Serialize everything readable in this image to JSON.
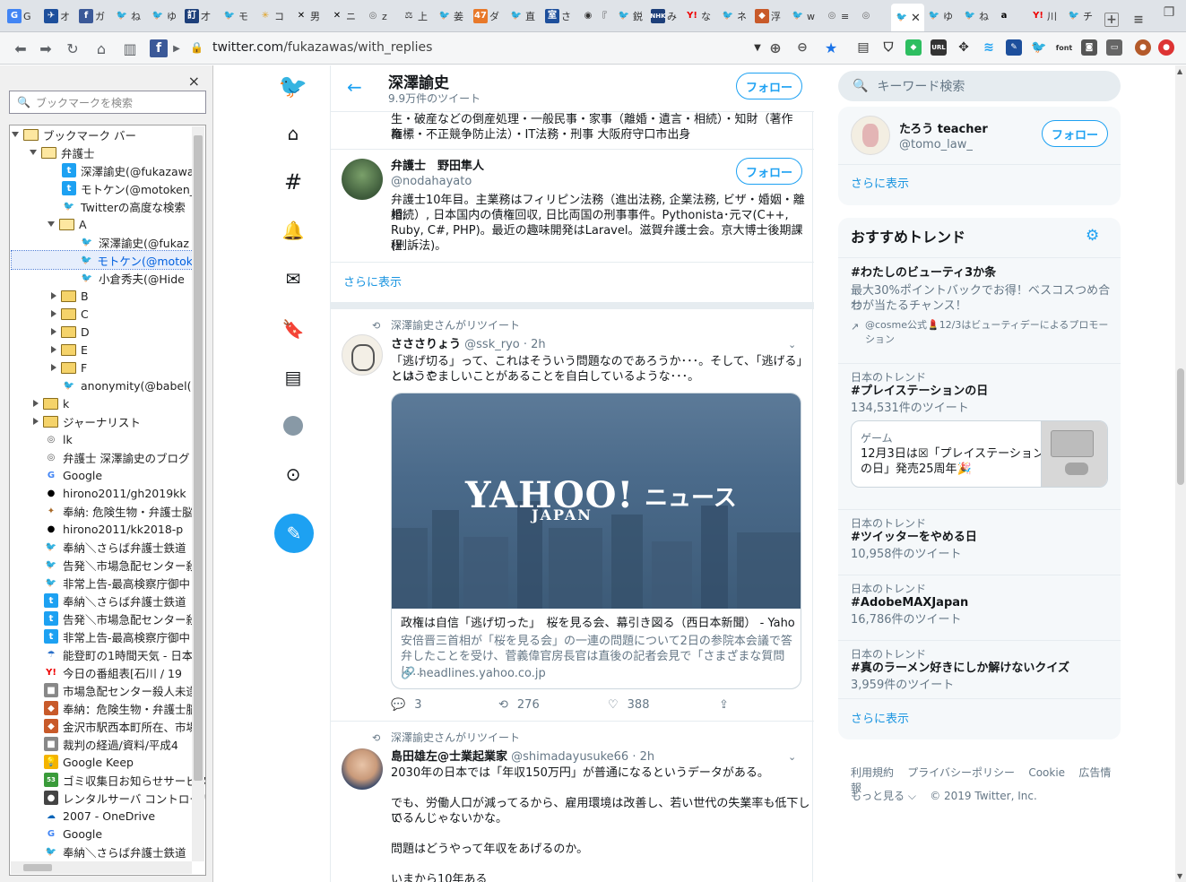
{
  "tabs": [
    {
      "label": "G"
    },
    {
      "label": "オ"
    },
    {
      "label": "ガ"
    },
    {
      "label": "ね"
    },
    {
      "label": "ゆ"
    },
    {
      "label": "才"
    },
    {
      "label": "訂"
    },
    {
      "label": "モ"
    },
    {
      "label": "コ"
    },
    {
      "label": "男"
    },
    {
      "label": "ニ"
    },
    {
      "label": "z"
    },
    {
      "label": "上"
    },
    {
      "label": "姜"
    },
    {
      "label": "ダ"
    },
    {
      "label": "直"
    },
    {
      "label": "さ"
    },
    {
      "label": "『"
    },
    {
      "label": "鋭"
    },
    {
      "label": "み"
    },
    {
      "label": "な"
    },
    {
      "label": "ネ"
    },
    {
      "label": "浮"
    },
    {
      "label": "w"
    },
    {
      "label": "≡"
    },
    {
      "label": "ゆ"
    },
    {
      "label": "ね"
    },
    {
      "label": "川"
    },
    {
      "label": "チ"
    }
  ],
  "url": {
    "host": "twitter.com",
    "path": "/fukazawas/with_replies"
  },
  "sidebar": {
    "close": "×",
    "search_placeholder": "ブックマークを検索",
    "tree": [
      {
        "label": "ブックマーク バー"
      },
      {
        "label": "弁護士"
      },
      {
        "label": "深澤諭史(@fukazawa"
      },
      {
        "label": "モトケン(@motoken_"
      },
      {
        "label": "Twitterの高度な検索"
      },
      {
        "label": "A"
      },
      {
        "label": "深澤諭史(@fukaz"
      },
      {
        "label": "モトケン(@motok"
      },
      {
        "label": "小倉秀夫(@Hide"
      },
      {
        "label": "B"
      },
      {
        "label": "C"
      },
      {
        "label": "D"
      },
      {
        "label": "E"
      },
      {
        "label": "F"
      },
      {
        "label": "anonymity(@babel("
      },
      {
        "label": "k"
      },
      {
        "label": "ジャーナリスト"
      },
      {
        "label": "lk"
      },
      {
        "label": "弁護士 深澤諭史のブログ"
      },
      {
        "label": "Google"
      },
      {
        "label": "hirono2011/gh2019kk"
      },
      {
        "label": "奉納: 危険生物・弁護士脳"
      },
      {
        "label": "hirono2011/kk2018-p"
      },
      {
        "label": "奉納＼さらば弁護士鉄道"
      },
      {
        "label": "告発＼市場急配センター殺"
      },
      {
        "label": "非常上告-最高検察庁御中"
      },
      {
        "label": "奉納＼さらば弁護士鉄道"
      },
      {
        "label": "告発＼市場急配センター殺"
      },
      {
        "label": "非常上告-最高検察庁御中"
      },
      {
        "label": "能登町の1時間天気 - 日本"
      },
      {
        "label": "今日の番組表[石川 / 19"
      },
      {
        "label": "市場急配センター殺人未遂"
      },
      {
        "label": "奉納：危険生物・弁護士脳"
      },
      {
        "label": "金沢市駅西本町所在、市場"
      },
      {
        "label": "裁判の経過/資料/平成4"
      },
      {
        "label": "Google Keep"
      },
      {
        "label": "ゴミ収集日お知らせサービス"
      },
      {
        "label": "レンタルサーバ コントロール"
      },
      {
        "label": "2007 - OneDrive"
      },
      {
        "label": "Google"
      },
      {
        "label": "奉納＼さらば弁護士鉄道"
      }
    ]
  },
  "header": {
    "name": "深澤諭史",
    "count": "9.9万件のツイート",
    "follow": "フォロー"
  },
  "bio1": {
    "line1": "生・破産などの倒産処理・一般民事・家事（離婚・遺言・相続）・知財（著作権・",
    "line2": "商標・不正競争防止法）・IT法務・刑事 大阪府守口市出身"
  },
  "user2": {
    "name": "弁護士　野田隼人",
    "handle": "@nodahayato",
    "follow": "フォロー",
    "bio": [
      "弁護士10年目。主業務はフィリピン法務（進出法務, 企業法務, ビザ・婚姻・離婚,",
      "相続）, 日本国内の債権回収, 日比両国の刑事事件。Pythonista･元マ(C++,",
      "Ruby, C#, PHP)。最近の趣味開発はLaravel。滋賀弁護士会。京大博士後期課程",
      "(刑訴法)。"
    ]
  },
  "show_more": "さらに表示",
  "tweet1": {
    "retweet": "深澤諭史さんがリツイート",
    "name": "さささりょう",
    "handle": "@ssk_ryo",
    "time": "· 2h",
    "text1": "「逃げ切る」って、これはそういう問題なのであろうか･･･。そして、「逃げる」というこ",
    "text2": "とは、やましいことがあることを自白しているような･･･。",
    "card": {
      "logo": "YAHOO!",
      "logo_sub": "JAPAN",
      "logo_news": "ニュース",
      "title": "政権は自信「逃げ切った」　桜を見る会、幕引き図る（西日本新聞） - Yahoo…",
      "desc1": "安倍晋三首相が「桜を見る会」の一連の問題について2日の参院本会議で答",
      "desc2": "弁したことを受け、菅義偉官房長官は直後の記者会見で「さまざまな質問に…",
      "domain": "headlines.yahoo.co.jp"
    },
    "replies": "3",
    "retweets": "276",
    "likes": "388"
  },
  "tweet2": {
    "retweet": "深澤諭史さんがリツイート",
    "name": "島田雄左@士業起業家",
    "handle": "@shimadayusuke66",
    "time": "· 2h",
    "lines": [
      "2030年の日本では「年収150万円」が普通になるというデータがある。",
      "",
      "でも、労働人口が減ってるから、雇用環境は改善し、若い世代の失業率も低下して",
      "いるんじゃないかな。",
      "",
      "問題はどうやって年収をあげるのか。",
      "",
      "いまから10年ある"
    ]
  },
  "right": {
    "search_placeholder": "キーワード検索",
    "suggest": {
      "name": "たろう teacher",
      "handle": "@tomo_law_",
      "follow": "フォロー"
    },
    "show_more": "さらに表示",
    "trends_title": "おすすめトレンド",
    "promo": {
      "tag": "#わたしのビューティ3か条",
      "desc1": "最大30%ポイントバックでお得！ベスコスつめ合わ",
      "desc2": "せが当たるチャンス！",
      "by1": "@cosme公式💄12/3はビューティデーによるプロモー",
      "by2": "ション"
    },
    "trends": [
      {
        "ctx": "日本のトレンド",
        "tag": "#プレイステーションの日",
        "count": "134,531件のツイート"
      },
      {
        "ctx": "日本のトレンド",
        "tag": "#ツイッターをやめる日",
        "count": "10,958件のツイート"
      },
      {
        "ctx": "日本のトレンド",
        "tag": "#AdobeMAXJapan",
        "count": "16,786件のツイート"
      },
      {
        "ctx": "日本のトレンド",
        "tag": "#真のラーメン好きにしか解けないクイズ",
        "count": "3,959件のツイート"
      }
    ],
    "game": {
      "ctx": "ゲーム",
      "line1": "12月3日は☒「プレイステーション",
      "line2": "の日」発売25周年🎉"
    },
    "footer": {
      "terms": "利用規約",
      "privacy": "プライバシーポリシー",
      "cookie": "Cookie",
      "ads": "広告情報",
      "more": "もっと見る ⌵",
      "copy": "© 2019 Twitter, Inc."
    }
  }
}
